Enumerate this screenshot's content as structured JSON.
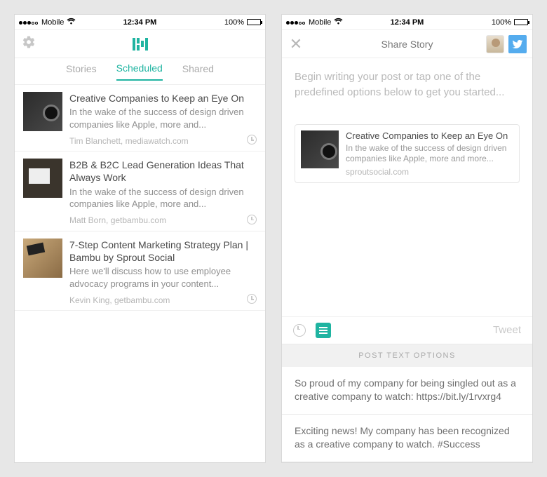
{
  "statusbar": {
    "carrier": "Mobile",
    "time": "12:34 PM",
    "battery_pct": "100%"
  },
  "tabs": {
    "stories": "Stories",
    "scheduled": "Scheduled",
    "shared": "Shared"
  },
  "stories": [
    {
      "title": "Creative Companies to Keep an Eye On",
      "desc": "In the wake of the success of design driven companies like Apple, more and...",
      "meta": "Tim Blanchett, mediawatch.com"
    },
    {
      "title": "B2B & B2C Lead Generation Ideas That Always Work",
      "desc": "In the wake of the success of design driven companies like Apple, more and...",
      "meta": "Matt Born, getbambu.com"
    },
    {
      "title": "7-Step Content Marketing Strategy Plan | Bambu by Sprout Social",
      "desc": "Here we'll discuss how to use employee advocacy programs in your content...",
      "meta": "Kevin King, getbambu.com"
    }
  ],
  "share": {
    "title": "Share Story",
    "placeholder": "Begin writing your post or tap one of the predefined options below to get you started...",
    "card": {
      "title": "Creative Companies to Keep an Eye On",
      "desc": "In the wake of the success of design driven companies like Apple, more and more...",
      "source": "sproutsocial.com"
    },
    "tweet_label": "Tweet",
    "options_header": "POST TEXT OPTIONS",
    "options": [
      "So proud of my company for being singled out as a creative company to watch: https://bit.ly/1rvxrg4",
      "Exciting news! My company has been recognized as a creative company to watch. #Success"
    ]
  }
}
